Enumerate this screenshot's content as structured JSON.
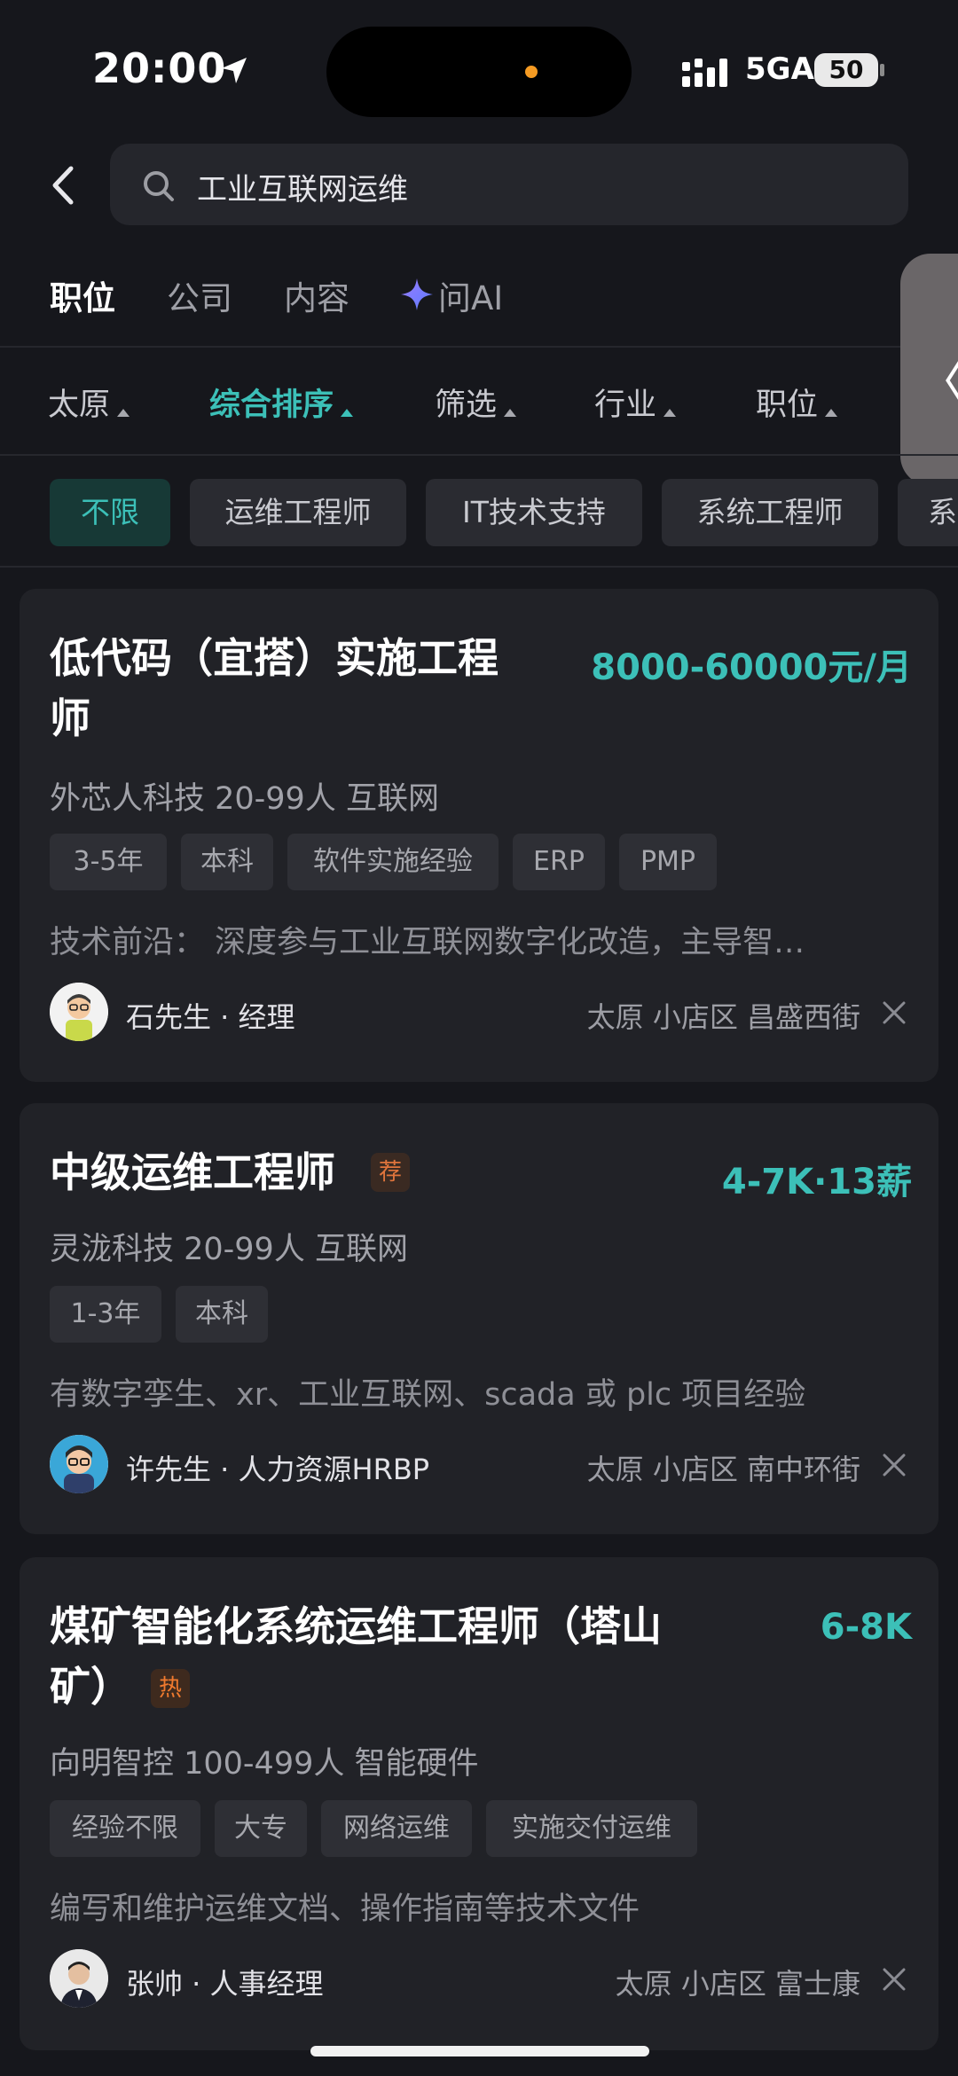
{
  "status_bar": {
    "time": "20:00",
    "network": "5GA",
    "battery": "50"
  },
  "search": {
    "query": "工业互联网运维"
  },
  "tabs": [
    {
      "label": "职位"
    },
    {
      "label": "公司"
    },
    {
      "label": "内容"
    },
    {
      "label": "问AI"
    }
  ],
  "filters": [
    {
      "label": "太原"
    },
    {
      "label": "综合排序"
    },
    {
      "label": "筛选"
    },
    {
      "label": "行业"
    },
    {
      "label": "职位"
    }
  ],
  "chips": [
    {
      "label": "不限"
    },
    {
      "label": "运维工程师"
    },
    {
      "label": "IT技术支持"
    },
    {
      "label": "系统工程师"
    },
    {
      "label": "系"
    }
  ],
  "jobs": [
    {
      "title_line1": "低代码（宜搭）实施工程",
      "title_line2": "师",
      "salary": "8000-60000元/月",
      "company": "外芯人科技 20-99人 互联网",
      "tags": [
        "3-5年",
        "本科",
        "软件实施经验",
        "ERP",
        "PMP"
      ],
      "desc": "技术前沿：  深度参与工业互联网数字化改造，主导智…",
      "recruiter": "石先生 · 经理",
      "location": "太原 小店区 昌盛西街"
    },
    {
      "title_line1": "中级运维工程师",
      "badge": "荐",
      "salary": "4-7K·13薪",
      "company": "灵泷科技 20-99人 互联网",
      "tags": [
        "1-3年",
        "本科"
      ],
      "desc": "有数字孪生、xr、工业互联网、scada 或 plc 项目经验",
      "recruiter": "许先生 · 人力资源HRBP",
      "location": "太原 小店区 南中环街"
    },
    {
      "title_line1": "煤矿智能化系统运维工程师（塔山",
      "title_line2": "矿）",
      "badge": "热",
      "salary": "6-8K",
      "company": "向明智控 100-499人 智能硬件",
      "tags": [
        "经验不限",
        "大专",
        "网络运维",
        "实施交付运维"
      ],
      "desc": "编写和维护运维文档、操作指南等技术文件",
      "recruiter": "张帅 · 人事经理",
      "location": "太原 小店区 富士康"
    }
  ],
  "colors": {
    "accent": "#3cc0b8",
    "background": "#16171c",
    "card": "#212227"
  }
}
